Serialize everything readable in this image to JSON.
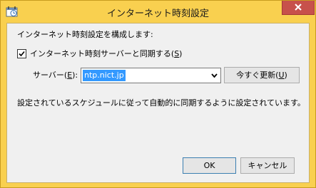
{
  "window": {
    "title": "インターネット時刻設定"
  },
  "dialog": {
    "heading": "インターネット時刻設定を構成します:",
    "sync_checkbox": {
      "label_prefix": "インターネット時刻サーバーと同期する(",
      "mnemonic": "S",
      "label_suffix": ")",
      "checked": true
    },
    "server": {
      "label_prefix": "サーバー(",
      "mnemonic": "E",
      "label_suffix": "):",
      "value": "ntp.nict.jp"
    },
    "update_button": {
      "label_prefix": "今すぐ更新(",
      "mnemonic": "U",
      "label_suffix": ")"
    },
    "status_text": "設定されているスケジュールに従って自動的に同期するように設定されています。",
    "ok_button": "OK",
    "cancel_button": "キャンセル"
  },
  "colors": {
    "frame": "#f9d04f",
    "close_button": "#c7514b",
    "selection": "#3399ff"
  },
  "icons": {
    "app": "date-time-icon",
    "close": "close-icon",
    "check": "checkmark-icon",
    "dropdown": "chevron-down-icon"
  }
}
